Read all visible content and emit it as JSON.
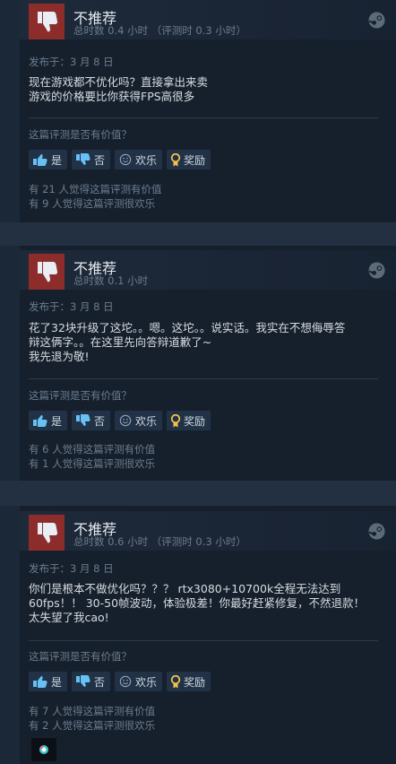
{
  "reviews": [
    {
      "recommendation": "不推荐",
      "hours": "总时数 0.4 小时  （评测时 0.3 小时）",
      "posted": "发布于：3 月 8 日",
      "body": [
        "现在游戏都不优化吗？直接拿出来卖",
        "游戏的价格要比你获得FPS高很多"
      ],
      "helpful_q": "这篇评测是否有价值？",
      "buttons": {
        "yes": "是",
        "no": "否",
        "funny": "欢乐",
        "award": "奖励"
      },
      "stats": [
        "有 21 人觉得这篇评测有价值",
        "有 9 人觉得这篇评测很欢乐"
      ]
    },
    {
      "recommendation": "不推荐",
      "hours": "总时数 0.1 小时",
      "posted": "发布于：3 月 8 日",
      "body": [
        "花了32块升级了这坨。。嗯。这坨。。说实话。我实在不想侮辱答",
        "辩这俩字。。在这里先向答辩道歉了~",
        "我先退为敬!"
      ],
      "helpful_q": "这篇评测是否有价值？",
      "buttons": {
        "yes": "是",
        "no": "否",
        "funny": "欢乐",
        "award": "奖励"
      },
      "stats": [
        "有 6 人觉得这篇评测有价值",
        "有 1 人觉得这篇评测很欢乐"
      ]
    },
    {
      "recommendation": "不推荐",
      "hours": "总时数 0.6 小时  （评测时 0.3 小时）",
      "posted": "发布于：3 月 8 日",
      "body": [
        "你们是根本不做优化吗？？？ rtx3080+10700k全程无法达到",
        "60fps！！ 30-50帧波动，体验极差！你最好赶紧修复，不然退款！",
        "太失望了我cao!"
      ],
      "helpful_q": "这篇评测是否有价值？",
      "buttons": {
        "yes": "是",
        "no": "否",
        "funny": "欢乐",
        "award": "奖励"
      },
      "stats": [
        "有 7 人觉得这篇评测有价值",
        "有 2 人觉得这篇评测很欢乐"
      ]
    }
  ],
  "colors": {
    "thumb_bg": "#8c2d2c",
    "award": "#f2c14b",
    "button_bg": "#213246"
  },
  "icons": [
    "thumbs-down-icon",
    "steam-icon",
    "thumbs-up-icon",
    "smile-icon",
    "award-icon"
  ]
}
